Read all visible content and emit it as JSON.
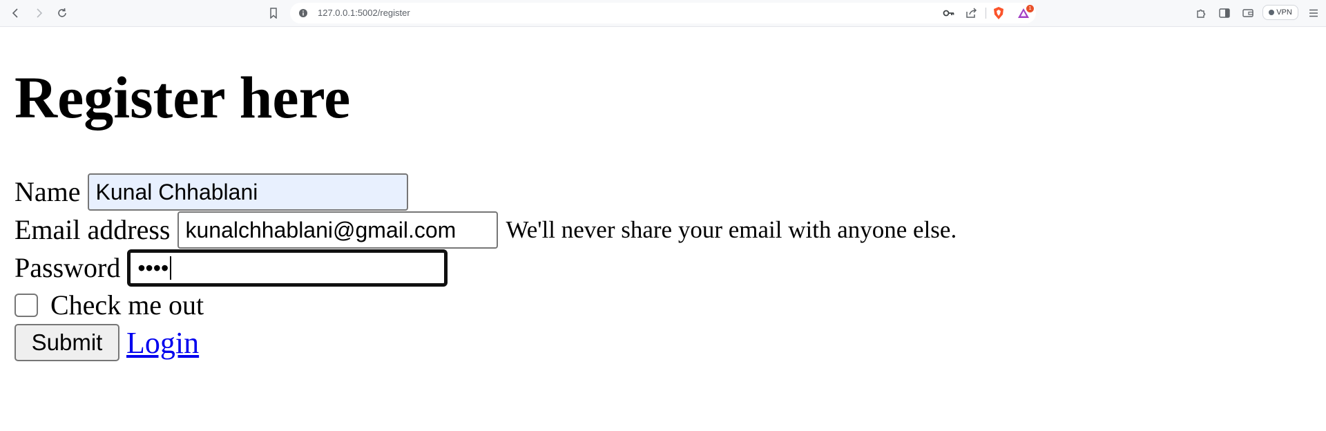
{
  "browser": {
    "url": "127.0.0.1:5002/register",
    "vpn_label": "VPN",
    "notification_count": "1"
  },
  "page": {
    "title": "Register here",
    "name_label": "Name",
    "name_value": "Kunal Chhablani",
    "email_label": "Email address",
    "email_value": "kunalchhablani@gmail.com",
    "email_help": "We'll never share your email with anyone else.",
    "password_label": "Password",
    "password_masked": "••••",
    "checkbox_label": "Check me out",
    "submit_label": "Submit",
    "login_link": "Login"
  },
  "icons": {
    "back": "back-arrow-icon",
    "forward": "forward-arrow-icon",
    "reload": "reload-icon",
    "bookmark": "bookmark-icon",
    "site_info": "site-info-icon",
    "key": "key-icon",
    "share": "share-icon",
    "brave": "brave-shields-icon",
    "rewards": "brave-rewards-icon",
    "extensions": "extensions-icon",
    "sidebar": "sidebar-icon",
    "wallet": "wallet-icon",
    "menu": "menu-icon"
  }
}
